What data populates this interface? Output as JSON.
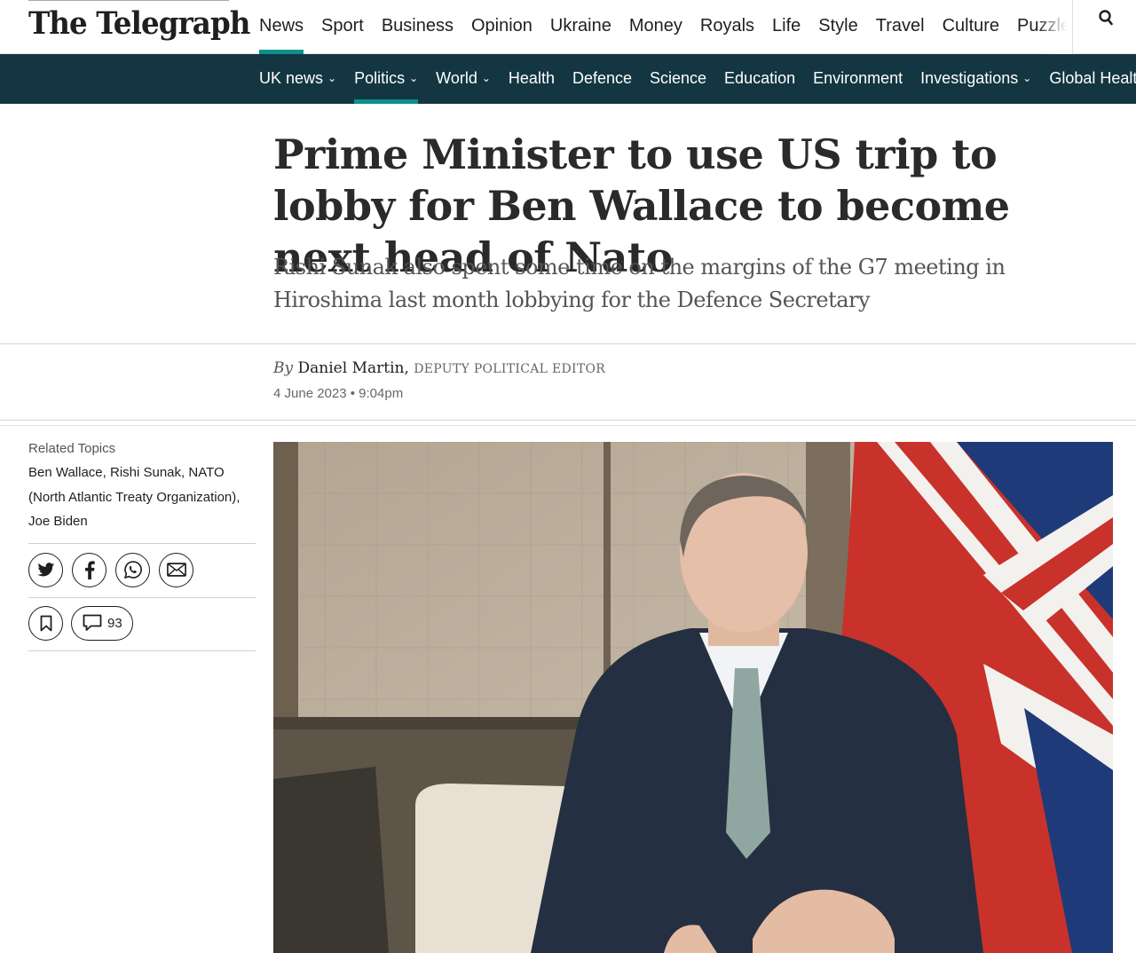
{
  "site": {
    "logo": "The Telegraph"
  },
  "main_nav": [
    {
      "label": "News",
      "active": true
    },
    {
      "label": "Sport"
    },
    {
      "label": "Business"
    },
    {
      "label": "Opinion"
    },
    {
      "label": "Ukraine"
    },
    {
      "label": "Money"
    },
    {
      "label": "Royals"
    },
    {
      "label": "Life"
    },
    {
      "label": "Style"
    },
    {
      "label": "Travel"
    },
    {
      "label": "Culture"
    },
    {
      "label": "Puzzles"
    }
  ],
  "sub_nav": [
    {
      "label": "UK news",
      "chevron": "⌄"
    },
    {
      "label": "Politics",
      "chevron": "⌄",
      "active": true
    },
    {
      "label": "World",
      "chevron": "⌄"
    },
    {
      "label": "Health"
    },
    {
      "label": "Defence"
    },
    {
      "label": "Science"
    },
    {
      "label": "Education"
    },
    {
      "label": "Environment"
    },
    {
      "label": "Investigations",
      "chevron": "⌄"
    },
    {
      "label": "Global Health"
    }
  ],
  "article": {
    "headline": "Prime Minister to use US trip to lobby for Ben Wallace to become next head of Nato",
    "standfirst": "Rishi Sunak also spent some time on the margins of the G7 meeting in Hiroshima last month lobbying for the Defence Secretary",
    "byline_prefix": "By",
    "author": "Daniel Martin,",
    "author_role": "DEPUTY POLITICAL EDITOR",
    "date": "4 June 2023 • 9:04pm"
  },
  "sidebar": {
    "related_label": "Related Topics",
    "related_links": "Ben Wallace, Rishi Sunak, NATO (North Atlantic Treaty Organization), Joe Biden",
    "share_icons": [
      "twitter-icon",
      "facebook-icon",
      "whatsapp-icon",
      "email-icon"
    ],
    "comment_count": "93"
  },
  "colors": {
    "accent": "#0e8f8b",
    "subnav_bg": "#133642"
  }
}
